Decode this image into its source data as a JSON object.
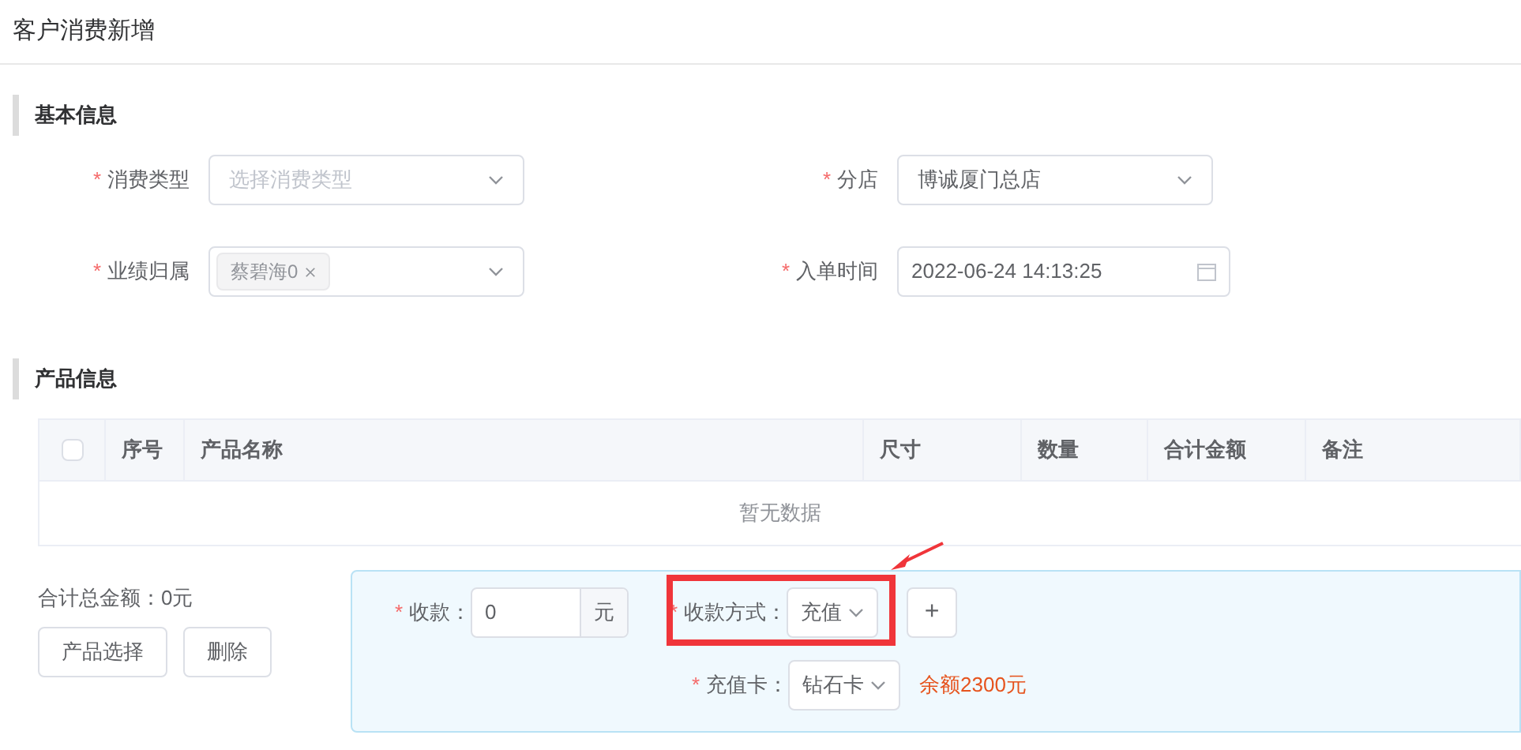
{
  "page_title": "客户消费新增",
  "basic_section": {
    "title": "基本信息",
    "fields": [
      {
        "label": "消费类型",
        "required_mark": "*",
        "kind": "select",
        "placeholder": "选择消费类型"
      },
      {
        "label": "分店",
        "required_mark": "*",
        "kind": "select",
        "value": "博诚厦门总店"
      },
      {
        "label": "业绩归属",
        "required_mark": "*",
        "kind": "tags",
        "tags": [
          "蔡碧海0"
        ]
      },
      {
        "label": "入单时间",
        "required_mark": "*",
        "kind": "date",
        "value": "2022-06-24 14:13:25"
      }
    ]
  },
  "product_section": {
    "title": "产品信息",
    "table": {
      "checked": false,
      "columns": [
        "序号",
        "产品名称",
        "尺寸",
        "数量",
        "合计金额",
        "备注"
      ],
      "empty_text": "暂无数据"
    }
  },
  "total_text": "合计总金额：0元",
  "buttons": [
    "产品选择",
    "删除"
  ],
  "payment": {
    "amount_label": "收款：",
    "amount_mark": "*",
    "amount_value": "0",
    "amount_unit": "元",
    "method_label": "收款方式：",
    "method_mark": "*",
    "method_value": "充值",
    "add_button": "+",
    "card_label": "充值卡：",
    "card_mark": "*",
    "card_value": "钻石卡",
    "balance": "余额2300元"
  }
}
